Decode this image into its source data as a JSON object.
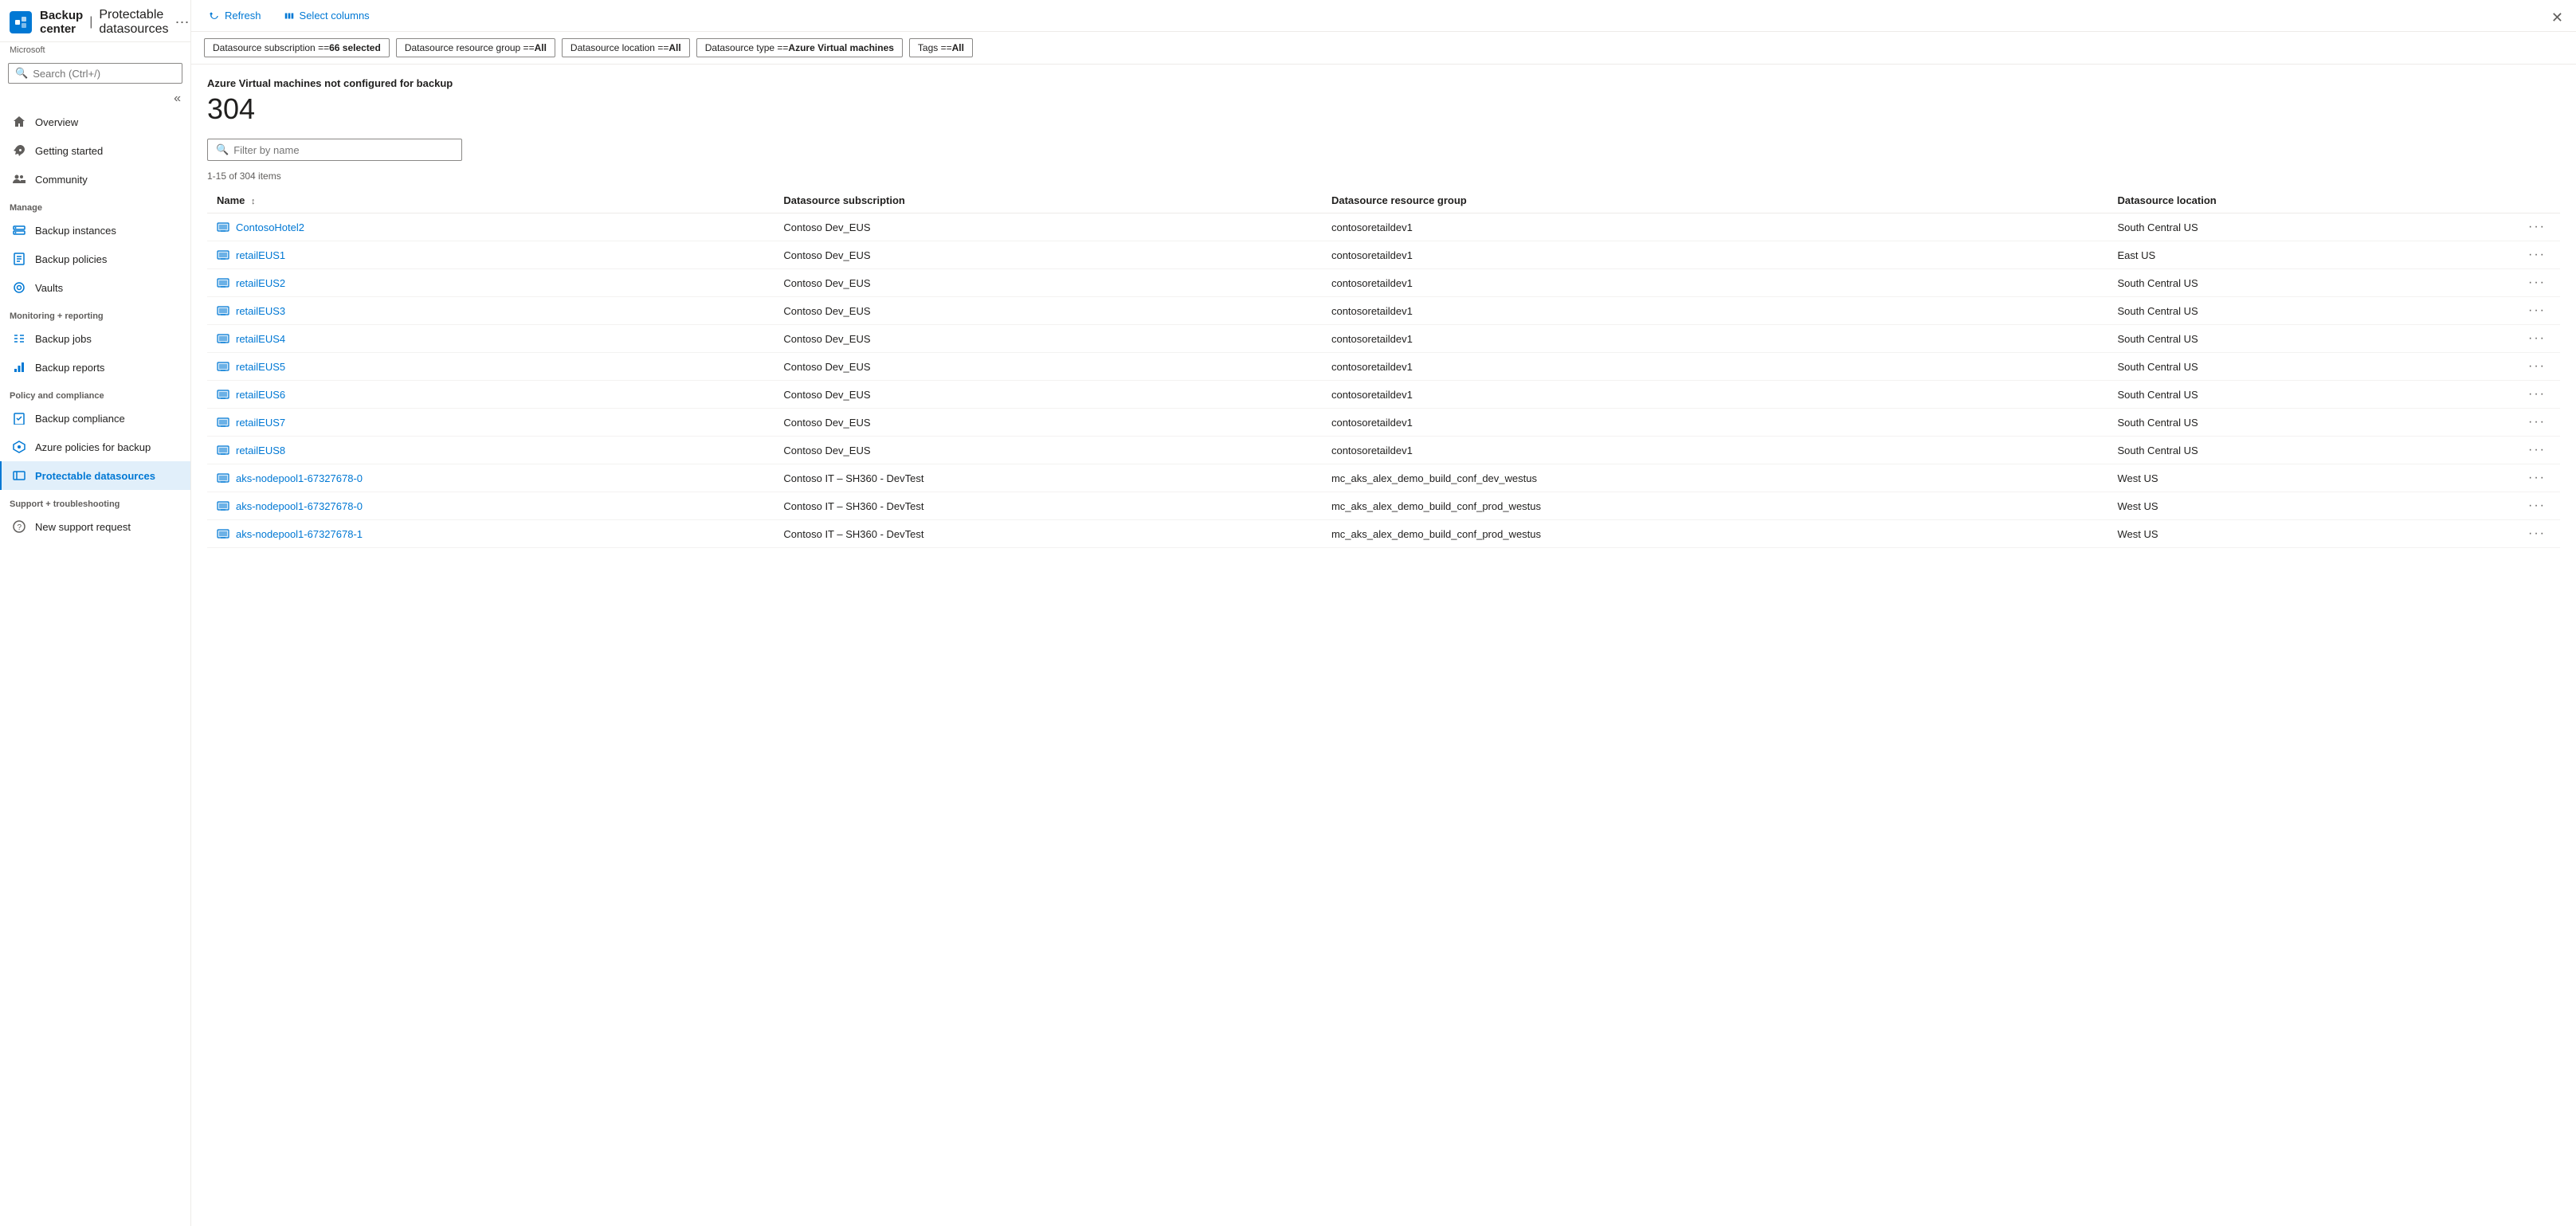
{
  "window": {
    "title": "Backup center",
    "subtitle": "Protectable datasources",
    "provider": "Microsoft",
    "more_icon": "⋯",
    "close_icon": "✕"
  },
  "sidebar": {
    "search_placeholder": "Search (Ctrl+/)",
    "collapse_icon": "«",
    "nav": {
      "general": [
        {
          "id": "overview",
          "label": "Overview",
          "icon": "home"
        },
        {
          "id": "getting-started",
          "label": "Getting started",
          "icon": "rocket"
        },
        {
          "id": "community",
          "label": "Community",
          "icon": "people"
        }
      ],
      "manage_label": "Manage",
      "manage": [
        {
          "id": "backup-instances",
          "label": "Backup instances",
          "icon": "instances"
        },
        {
          "id": "backup-policies",
          "label": "Backup policies",
          "icon": "policy"
        },
        {
          "id": "vaults",
          "label": "Vaults",
          "icon": "vault"
        }
      ],
      "monitoring_label": "Monitoring + reporting",
      "monitoring": [
        {
          "id": "backup-jobs",
          "label": "Backup jobs",
          "icon": "jobs"
        },
        {
          "id": "backup-reports",
          "label": "Backup reports",
          "icon": "reports"
        }
      ],
      "policy_label": "Policy and compliance",
      "policy": [
        {
          "id": "backup-compliance",
          "label": "Backup compliance",
          "icon": "compliance"
        },
        {
          "id": "azure-policies",
          "label": "Azure policies for backup",
          "icon": "azure-policy"
        },
        {
          "id": "protectable-datasources",
          "label": "Protectable datasources",
          "icon": "datasource",
          "active": true
        }
      ],
      "support_label": "Support + troubleshooting",
      "support": [
        {
          "id": "new-support",
          "label": "New support request",
          "icon": "support"
        }
      ]
    }
  },
  "toolbar": {
    "refresh_label": "Refresh",
    "select_columns_label": "Select columns"
  },
  "filters": [
    {
      "id": "subscription",
      "label": "Datasource subscription == ",
      "value": "66 selected",
      "bold_value": true
    },
    {
      "id": "resource-group",
      "label": "Datasource resource group == ",
      "value": "All",
      "bold_value": true
    },
    {
      "id": "location",
      "label": "Datasource location == ",
      "value": "All",
      "bold_value": true
    },
    {
      "id": "type",
      "label": "Datasource type == ",
      "value": "Azure Virtual machines",
      "bold_value": true
    },
    {
      "id": "tags",
      "label": "Tags == ",
      "value": "All",
      "bold_value": true
    }
  ],
  "content": {
    "summary_title": "Azure Virtual machines not configured for backup",
    "summary_count": "304",
    "filter_placeholder": "Filter by name",
    "items_range": "1-15 of 304 items",
    "columns": [
      {
        "id": "name",
        "label": "Name",
        "sortable": true
      },
      {
        "id": "subscription",
        "label": "Datasource subscription",
        "sortable": false
      },
      {
        "id": "resource-group",
        "label": "Datasource resource group",
        "sortable": false
      },
      {
        "id": "location",
        "label": "Datasource location",
        "sortable": false
      }
    ],
    "rows": [
      {
        "name": "ContosoHotel2",
        "subscription": "Contoso Dev_EUS",
        "resource_group": "contosoretaildev1",
        "location": "South Central US"
      },
      {
        "name": "retailEUS1",
        "subscription": "Contoso Dev_EUS",
        "resource_group": "contosoretaildev1",
        "location": "East US"
      },
      {
        "name": "retailEUS2",
        "subscription": "Contoso Dev_EUS",
        "resource_group": "contosoretaildev1",
        "location": "South Central US"
      },
      {
        "name": "retailEUS3",
        "subscription": "Contoso Dev_EUS",
        "resource_group": "contosoretaildev1",
        "location": "South Central US"
      },
      {
        "name": "retailEUS4",
        "subscription": "Contoso Dev_EUS",
        "resource_group": "contosoretaildev1",
        "location": "South Central US"
      },
      {
        "name": "retailEUS5",
        "subscription": "Contoso Dev_EUS",
        "resource_group": "contosoretaildev1",
        "location": "South Central US"
      },
      {
        "name": "retailEUS6",
        "subscription": "Contoso Dev_EUS",
        "resource_group": "contosoretaildev1",
        "location": "South Central US"
      },
      {
        "name": "retailEUS7",
        "subscription": "Contoso Dev_EUS",
        "resource_group": "contosoretaildev1",
        "location": "South Central US"
      },
      {
        "name": "retailEUS8",
        "subscription": "Contoso Dev_EUS",
        "resource_group": "contosoretaildev1",
        "location": "South Central US"
      },
      {
        "name": "aks-nodepool1-67327678-0",
        "subscription": "Contoso IT – SH360 - DevTest",
        "resource_group": "mc_aks_alex_demo_build_conf_dev_westus",
        "location": "West US"
      },
      {
        "name": "aks-nodepool1-67327678-0",
        "subscription": "Contoso IT – SH360 - DevTest",
        "resource_group": "mc_aks_alex_demo_build_conf_prod_westus",
        "location": "West US"
      },
      {
        "name": "aks-nodepool1-67327678-1",
        "subscription": "Contoso IT – SH360 - DevTest",
        "resource_group": "mc_aks_alex_demo_build_conf_prod_westus",
        "location": "West US"
      }
    ]
  }
}
